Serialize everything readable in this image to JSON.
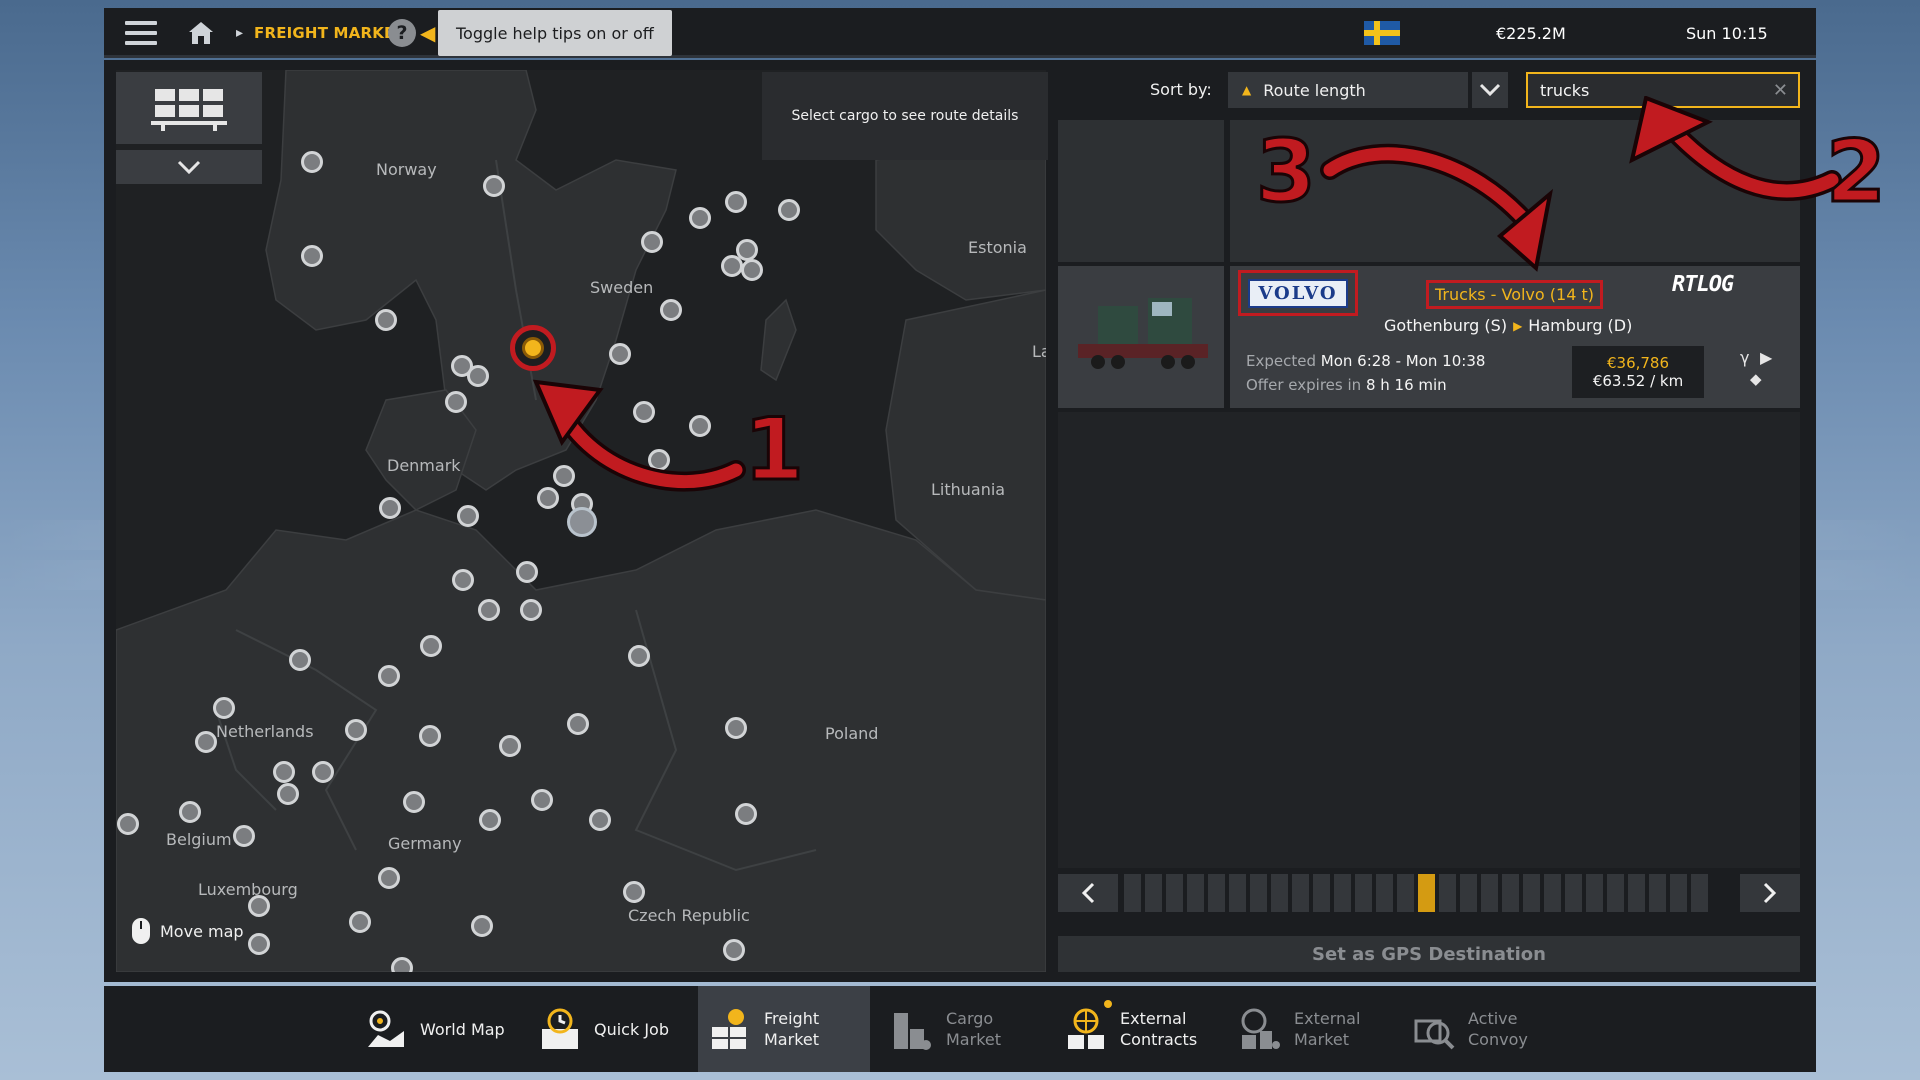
{
  "topbar": {
    "breadcrumb": "FREIGHT MARKET",
    "help_tooltip": "Toggle help tips on or off",
    "money": "€225.2M",
    "clock": "Sun 10:15",
    "flag_icon": "sweden-flag-icon"
  },
  "map": {
    "route_hint": "Select cargo to see route details",
    "move_map": "Move map",
    "countries": [
      "Norway",
      "Sweden",
      "Estonia",
      "La",
      "Denmark",
      "Lithuania",
      "Netherlands",
      "Poland",
      "Belgium",
      "Germany",
      "Luxembourg",
      "Czech Republic"
    ]
  },
  "sort": {
    "label": "Sort by:",
    "value": "Route length"
  },
  "search": {
    "value": "trucks"
  },
  "job": {
    "brand": "VOLVO",
    "cargo": "Trucks - Volvo (14 t)",
    "origin": "Gothenburg (S)",
    "destination": "Hamburg (D)",
    "expected_label": "Expected",
    "expected_value": "Mon 6:28 - Mon 10:38",
    "expires_label": "Offer expires in",
    "expires_value": "8 h 16 min",
    "revenue": "€36,786",
    "per_km": "€63.52 / km",
    "company": "RTLOG"
  },
  "pager": {
    "pages": 28,
    "active_page": 14
  },
  "gps_button": "Set as GPS Destination",
  "nav": {
    "tabs": [
      {
        "label1": "World Map",
        "label2": ""
      },
      {
        "label1": "Quick Job",
        "label2": ""
      },
      {
        "label1": "Freight",
        "label2": "Market"
      },
      {
        "label1": "Cargo",
        "label2": "Market"
      },
      {
        "label1": "External",
        "label2": "Contracts"
      },
      {
        "label1": "External",
        "label2": "Market"
      },
      {
        "label1": "Active",
        "label2": "Convoy"
      }
    ]
  },
  "annotations": [
    "1",
    "2",
    "3"
  ],
  "colors": {
    "accent": "#f2b51c",
    "annotation_red": "#c11b20",
    "panel": "#1b1d20"
  }
}
